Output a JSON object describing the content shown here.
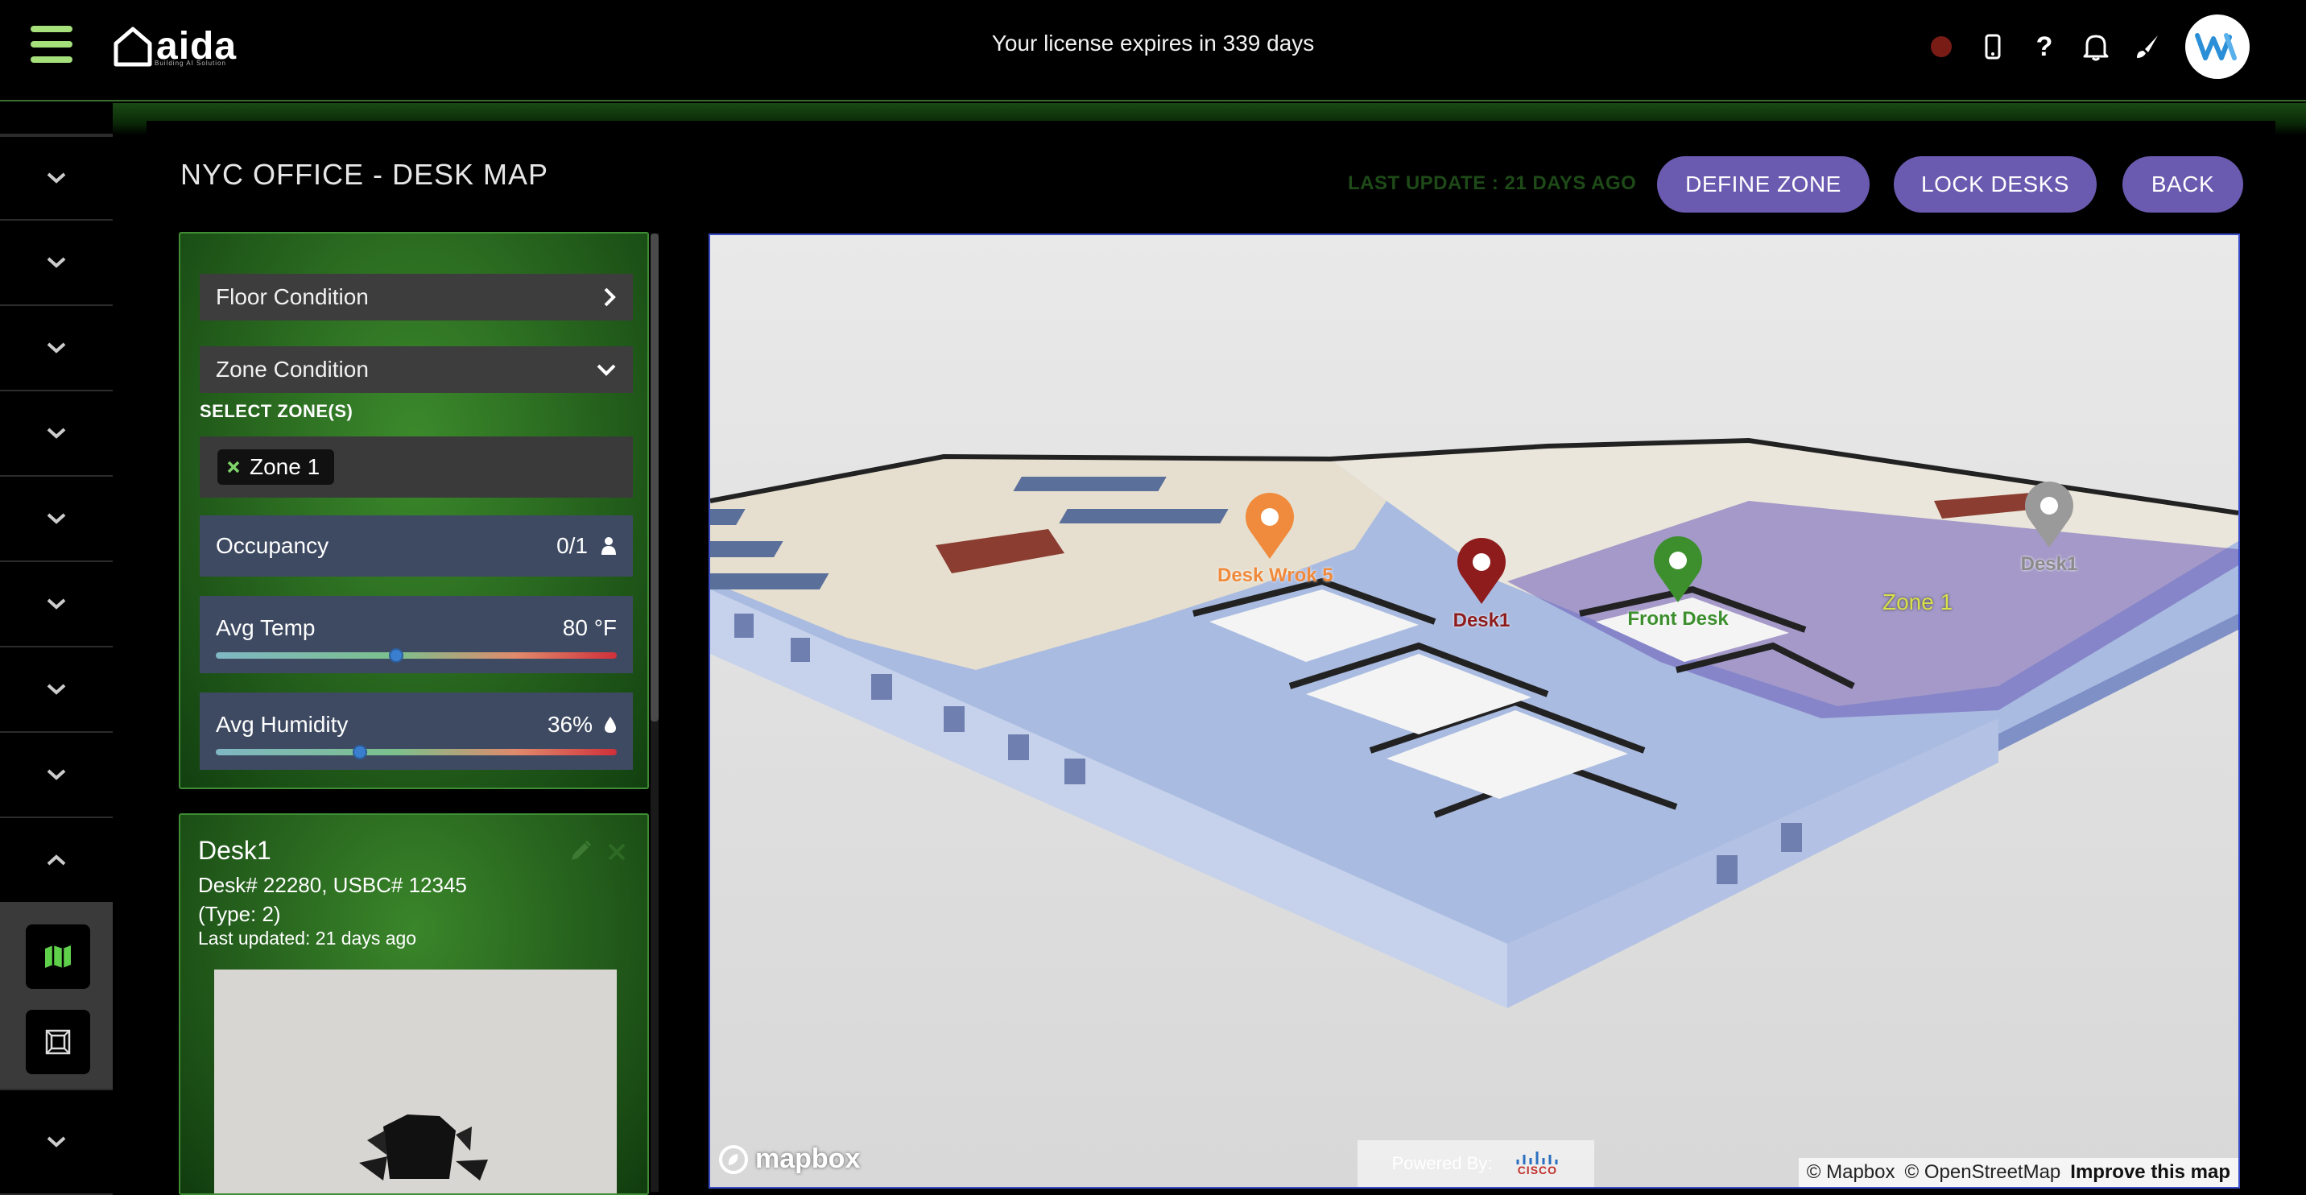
{
  "header": {
    "license_text": "Your license expires in 339 days",
    "logo_text": "aida",
    "logo_tagline": "Building AI Solution"
  },
  "page": {
    "title": "NYC OFFICE - DESK MAP",
    "last_update": "LAST UPDATE : 21 DAYS AGO",
    "buttons": {
      "define_zone": "DEFINE ZONE",
      "lock_desks": "LOCK DESKS",
      "back": "BACK"
    }
  },
  "conditions": {
    "floor_condition": "Floor Condition",
    "zone_condition": "Zone Condition",
    "select_zones_label": "SELECT ZONE(S)",
    "selected_zone": "Zone 1",
    "occupancy": {
      "label": "Occupancy",
      "value": "0/1"
    },
    "avg_temp": {
      "label": "Avg Temp",
      "value": "80 °F",
      "level": 0.45
    },
    "avg_humidity": {
      "label": "Avg Humidity",
      "value": "36%",
      "level": 0.36
    }
  },
  "desk_card": {
    "name": "Desk1",
    "ids": "Desk# 22280, USBC# 12345",
    "type": "(Type: 2)",
    "last_updated": "Last updated: 21 days ago"
  },
  "map": {
    "markers": [
      {
        "label": "Desk Wrok 5",
        "color": "#f08a3c"
      },
      {
        "label": "Desk1",
        "color": "#8e1c1c"
      },
      {
        "label": "Front Desk",
        "color": "#3d8f2e"
      },
      {
        "label": "Desk1",
        "color": "#9a9a9a"
      }
    ],
    "zone_label": "Zone 1",
    "mapbox_logo": "mapbox",
    "powered_by": "Powered By:",
    "powered_brand": "CISCO",
    "attribution_mapbox": "© Mapbox",
    "attribution_osm": "© OpenStreetMap",
    "improve": "Improve this map"
  },
  "colors": {
    "accent_purple": "#6b5bb0",
    "panel_green": "#2a6a20",
    "menu_green": "#a6e07a"
  }
}
